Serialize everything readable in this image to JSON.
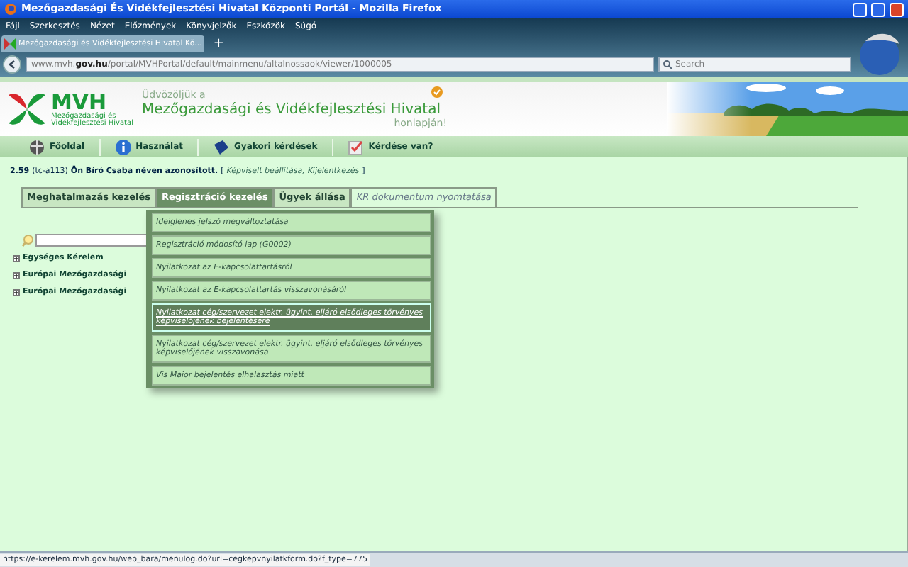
{
  "window": {
    "title": "Mezőgazdasági És Vidékfejlesztési Hivatal Központi Portál - Mozilla Firefox"
  },
  "menu_bar": [
    "Fájl",
    "Szerkesztés",
    "Nézet",
    "Előzmények",
    "Könyvjelzők",
    "Eszközök",
    "Súgó"
  ],
  "browser_tabs": [
    {
      "label": "Mezőgazdasági és Vidékfejlesztési Hivatal Kö...",
      "selected": true
    }
  ],
  "new_tab": "+",
  "address_bar": {
    "url_prefix": "www.mvh.",
    "url_domain": "gov.hu",
    "url_path": "/portal/MVHPortal/default/mainmenu/altalnossaok/viewer/1000005"
  },
  "search_box": {
    "placeholder": "Search"
  },
  "header": {
    "logo_text": "MVH",
    "logo_subtitle": "Mezőgazdasági és Vidékfejlesztési Hivatal",
    "greeting": "Üdvözöljük a",
    "site_name": "Mezőgazdasági és Vidékfejlesztési Hivatal",
    "greeting_end": "honlapján!"
  },
  "nav": [
    {
      "label": "Főoldal",
      "kind": "home"
    },
    {
      "label": "Használat",
      "kind": "info"
    },
    {
      "label": "Gyakori kérdések",
      "kind": "book"
    },
    {
      "label": "Kérdése van?",
      "kind": "check"
    }
  ],
  "login": {
    "version": "2.59",
    "server": "(tc-a113)",
    "message": "Ön Bíró Csaba néven azonosított.",
    "open_bracket": "[",
    "links": [
      "Képviselt beállítása,",
      "Kijelentkezés"
    ],
    "close_bracket": "]"
  },
  "tabs": [
    {
      "label": "Meghatalmazás kezelés",
      "selected": false
    },
    {
      "label": "Regisztráció kezelés",
      "selected": true
    },
    {
      "label": "Ügyek állása",
      "selected": false
    },
    {
      "label": "KR dokumentum nyomtatása",
      "selected": false
    }
  ],
  "dropdown": [
    {
      "label": "Ideiglenes jelszó megváltoztatása",
      "selected": false
    },
    {
      "label": "Regisztráció módosító lap (G0002)",
      "selected": false
    },
    {
      "label": "Nyilatkozat az E-kapcsolattartásról",
      "selected": false
    },
    {
      "label": "Nyilatkozat az E-kapcsolattartás visszavonásáról",
      "selected": false
    },
    {
      "label": "Nyilatkozat cég/szervezet elektr. ügyint. eljáró elsődleges törvényes képviselőjének bejelentésére",
      "selected": true
    },
    {
      "label": "Nyilatkozat cég/szervezet elektr. ügyint. eljáró elsődleges törvényes képviselőjének visszavonása",
      "selected": false
    },
    {
      "label": "Vis Maior bejelentés elhalasztás miatt",
      "selected": false
    }
  ],
  "tree": [
    {
      "label": "Egységes Kérelem",
      "expanded": false
    },
    {
      "label": "Európai Mezőgazdasági",
      "expanded": false
    },
    {
      "label": "Európai Mezőgazdasági",
      "expanded": false
    }
  ],
  "status_bar": "https://e-kerelem.mvh.gov.hu/web_bara/menulog.do?url=cegkepvnyilatkform.do?f_type=775"
}
